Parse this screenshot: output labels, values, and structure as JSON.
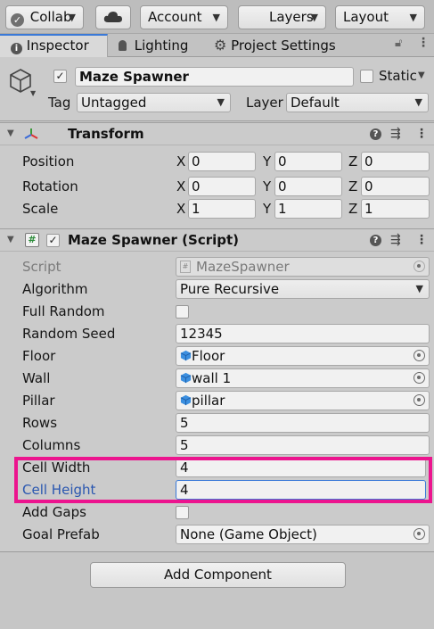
{
  "toolbar": {
    "collab_label": "Collab",
    "account_label": "Account",
    "layers_label": "Layers",
    "layout_label": "Layout"
  },
  "tabs": [
    {
      "label": "Inspector",
      "icon": "info-icon"
    },
    {
      "label": "Lighting",
      "icon": "bulb-icon"
    },
    {
      "label": "Project Settings",
      "icon": "gear-icon"
    }
  ],
  "gameobject": {
    "name": "Maze Spawner",
    "active": true,
    "static_label": "Static",
    "tag_label": "Tag",
    "tag_value": "Untagged",
    "layer_label": "Layer",
    "layer_value": "Default"
  },
  "transform": {
    "title": "Transform",
    "rows": [
      {
        "label": "Position",
        "x": "0",
        "y": "0",
        "z": "0"
      },
      {
        "label": "Rotation",
        "x": "0",
        "y": "0",
        "z": "0"
      },
      {
        "label": "Scale",
        "x": "1",
        "y": "1",
        "z": "1"
      }
    ],
    "axis_x": "X",
    "axis_y": "Y",
    "axis_z": "Z"
  },
  "script_component": {
    "title": "Maze Spawner (Script)",
    "enabled": true,
    "fields": {
      "script_label": "Script",
      "script_value": "MazeSpawner",
      "algorithm_label": "Algorithm",
      "algorithm_value": "Pure Recursive",
      "full_random_label": "Full Random",
      "random_seed_label": "Random Seed",
      "random_seed_value": "12345",
      "floor_label": "Floor",
      "floor_value": "Floor",
      "wall_label": "Wall",
      "wall_value": "wall 1",
      "pillar_label": "Pillar",
      "pillar_value": "pillar",
      "rows_label": "Rows",
      "rows_value": "5",
      "columns_label": "Columns",
      "columns_value": "5",
      "cell_width_label": "Cell Width",
      "cell_width_value": "4",
      "cell_height_label": "Cell Height",
      "cell_height_value": "4",
      "add_gaps_label": "Add Gaps",
      "goal_prefab_label": "Goal Prefab",
      "goal_prefab_value": "None (Game Object)"
    }
  },
  "add_component_label": "Add Component",
  "colors": {
    "highlight": "#ec148e",
    "focused_label": "#2a57b0",
    "tab_accent": "#3a79d8"
  }
}
